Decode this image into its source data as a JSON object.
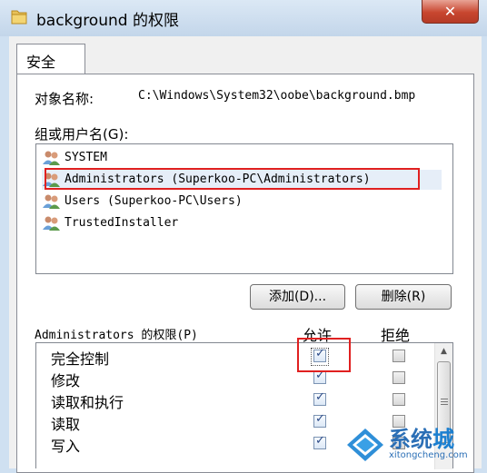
{
  "window": {
    "title": "background 的权限",
    "close_label": "✕"
  },
  "tabs": [
    {
      "label": "安全"
    }
  ],
  "object": {
    "label": "对象名称:",
    "path": "C:\\Windows\\System32\\oobe\\background.bmp"
  },
  "groups": {
    "label": "组或用户名(G):",
    "items": [
      {
        "label": "SYSTEM",
        "selected": false
      },
      {
        "label": "Administrators (Superkoo-PC\\Administrators)",
        "selected": true
      },
      {
        "label": "Users (Superkoo-PC\\Users)",
        "selected": false
      },
      {
        "label": "TrustedInstaller",
        "selected": false
      }
    ]
  },
  "buttons": {
    "add": "添加(D)...",
    "remove": "删除(R)"
  },
  "permissions": {
    "label": "Administrators 的权限(P)",
    "allow_header": "允许",
    "deny_header": "拒绝",
    "rows": [
      {
        "name": "完全控制",
        "allow": true,
        "deny": false
      },
      {
        "name": "修改",
        "allow": true,
        "deny": false
      },
      {
        "name": "读取和执行",
        "allow": true,
        "deny": false
      },
      {
        "name": "读取",
        "allow": true,
        "deny": false
      },
      {
        "name": "写入",
        "allow": true,
        "deny": false
      }
    ]
  },
  "watermark": {
    "text_a": "系统",
    "text_b": "城",
    "url": "xitongcheng.com"
  },
  "colors": {
    "title_bar": "#c3d6ea",
    "close_button": "#c8462f",
    "highlight": "#e02020",
    "check": "#2c4a87",
    "watermark": "#2b6fb6"
  }
}
